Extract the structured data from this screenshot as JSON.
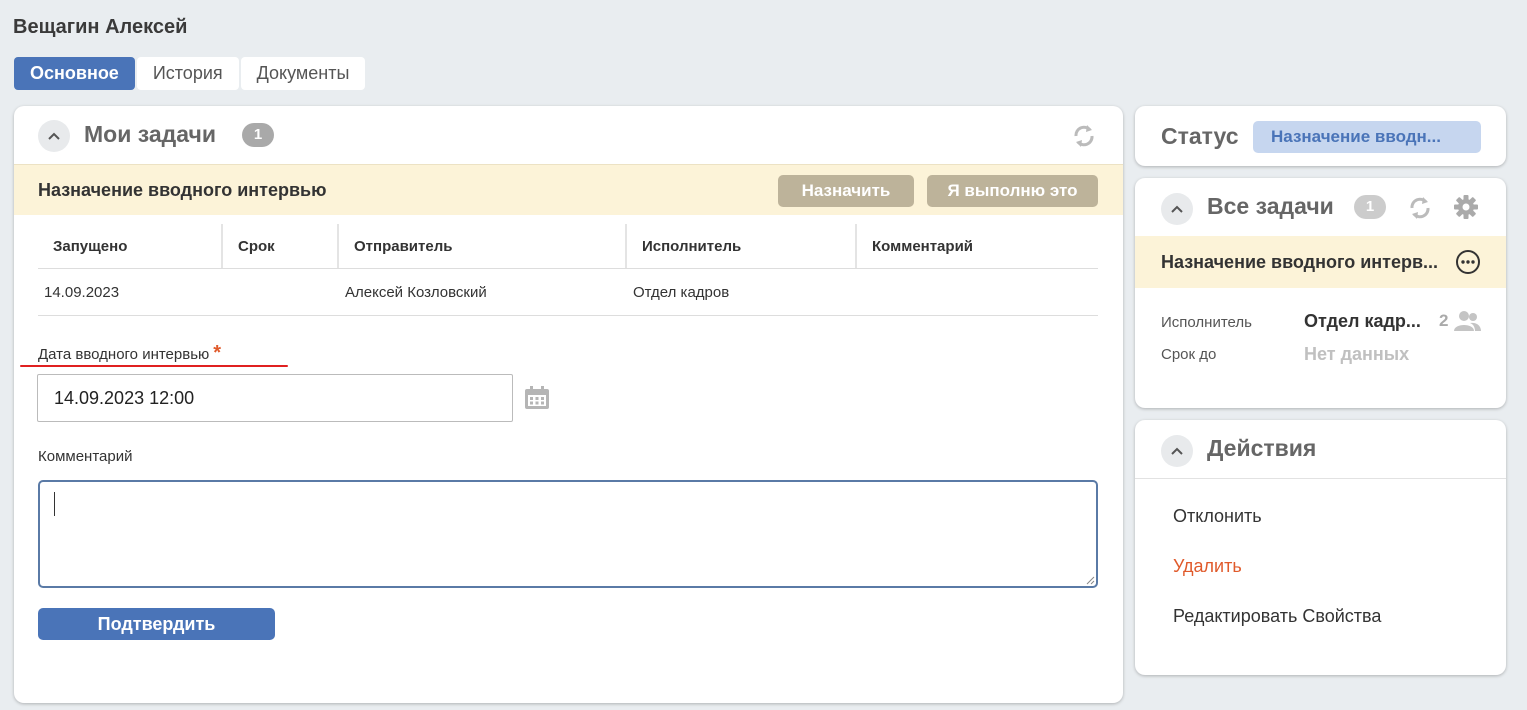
{
  "page": {
    "title": "Вещагин Алексей"
  },
  "tabs": [
    {
      "label": "Основное",
      "active": true
    },
    {
      "label": "История"
    },
    {
      "label": "Документы"
    }
  ],
  "my_tasks": {
    "title": "Мои задачи",
    "count": "1",
    "task": {
      "title": "Назначение вводного интервью",
      "assign_label": "Назначить",
      "take_label": "Я выполню это"
    },
    "table": {
      "headers": [
        "Запущено",
        "Срок",
        "Отправитель",
        "Исполнитель",
        "Комментарий"
      ],
      "rows": [
        [
          "14.09.2023",
          "",
          "Алексей Козловский",
          "Отдел кадров",
          ""
        ]
      ]
    },
    "form": {
      "date_label": "Дата вводного интервью",
      "required_mark": "*",
      "date_value": "14.09.2023 12:00",
      "comment_label": "Комментарий",
      "comment_value": "",
      "confirm_label": "Подтвердить"
    }
  },
  "status": {
    "label": "Статус",
    "value": "Назначение вводн..."
  },
  "all_tasks": {
    "title": "Все задачи",
    "count": "1",
    "task_title": "Назначение вводного интерв...",
    "assignee_label": "Исполнитель",
    "assignee_value": "Отдел кадр...",
    "assignee_count": "2",
    "due_label": "Срок до",
    "due_value": "Нет данных"
  },
  "actions": {
    "title": "Действия",
    "items": [
      {
        "label": "Отклонить"
      },
      {
        "label": "Удалить",
        "danger": true
      },
      {
        "label": "Редактировать Свойства"
      }
    ]
  },
  "colors": {
    "accent": "#4a74b8",
    "task_highlight": "#fcf3d8",
    "danger": "#e05a2b",
    "background": "#e9edf0"
  }
}
